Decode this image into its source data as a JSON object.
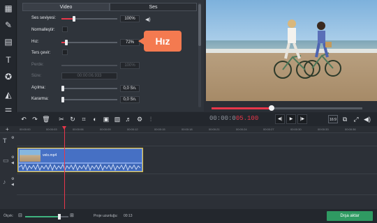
{
  "panel": {
    "tabs": [
      {
        "label": "Video",
        "active": true
      },
      {
        "label": "Ses",
        "active": false
      }
    ],
    "properties": {
      "volume": {
        "label": "Ses seviyesi:",
        "value": "100%",
        "level": 0.2
      },
      "normalize": {
        "label": "Normalleştir:"
      },
      "speed": {
        "label": "Hız:",
        "value": "72%",
        "level": 0.06
      },
      "reverse": {
        "label": "Ters çevir:"
      },
      "pitch": {
        "label": "Perde:",
        "value": "100%"
      },
      "duration": {
        "label": "Süre:",
        "value": "00:00:06.933"
      },
      "fade_in": {
        "label": "Açılma:",
        "value": "0,0 Sn."
      },
      "fade_out": {
        "label": "Kararma:",
        "value": "0,0 Sn."
      }
    },
    "callout": "Hız"
  },
  "preview": {
    "progress": 0.4
  },
  "toolbar": {
    "timecode_dim": "00:00:0",
    "timecode_red": "05.100",
    "aspect": "16:9"
  },
  "timeline": {
    "ticks": [
      "00:00:00",
      "00:00:03",
      "00:00:06",
      "00:00:09",
      "00:00:12",
      "00:00:15",
      "00:00:18",
      "00:00:21",
      "00:00:24",
      "00:00:27",
      "00:00:30",
      "00:00:33",
      "00:00:36"
    ],
    "clip_name": "velo.mp4"
  },
  "bottom": {
    "zoom_label": "Ölçek:",
    "project_length_label": "Proje uzunluğu:",
    "project_length_value": "00:13",
    "zoom_level": 0.75,
    "export_label": "Dışa aktar"
  }
}
